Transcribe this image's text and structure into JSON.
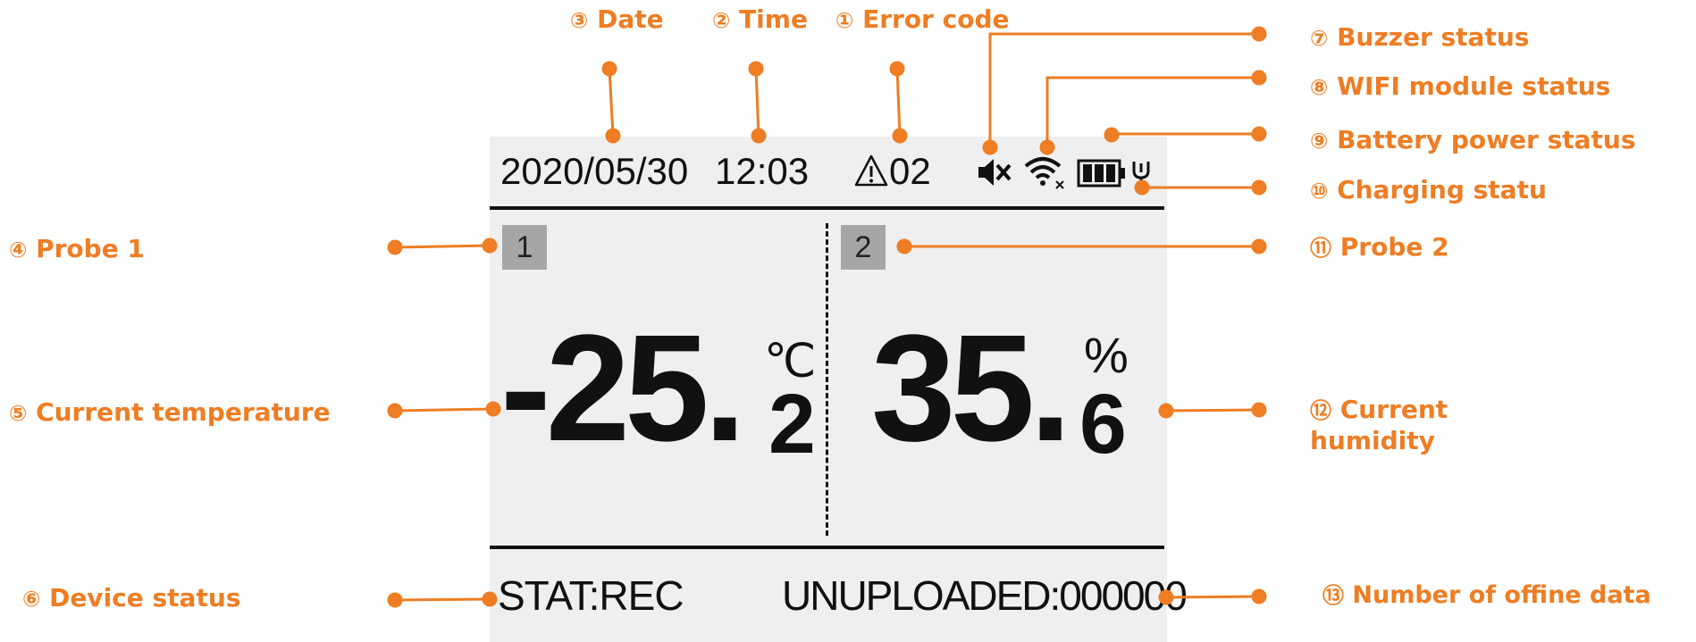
{
  "display": {
    "date": "2020/05/30",
    "time": "12:03",
    "error_code": "02",
    "probe1_badge": "1",
    "probe2_badge": "2",
    "temperature_int": "-25.",
    "temperature_dec": "2",
    "temperature_unit": "℃",
    "humidity_int": "35.",
    "humidity_dec": "6",
    "humidity_unit": "%",
    "status": "STAT:REC",
    "unuploaded": "UNUPLOADED:000000"
  },
  "callouts": {
    "error_code": {
      "num": "①",
      "text": "Error code"
    },
    "time": {
      "num": "②",
      "text": "Time"
    },
    "date": {
      "num": "③",
      "text": "Date"
    },
    "probe1": {
      "num": "④",
      "text": "Probe 1"
    },
    "current_temperature": {
      "num": "⑤",
      "text": "Current temperature"
    },
    "device_status": {
      "num": "⑥",
      "text": "Device status"
    },
    "buzzer_status": {
      "num": "⑦",
      "text": "Buzzer status"
    },
    "wifi_status": {
      "num": "⑧",
      "text": "WIFI module status"
    },
    "battery_status": {
      "num": "⑨",
      "text": "Battery power status"
    },
    "charging_status": {
      "num": "⑩",
      "text": "Charging statu"
    },
    "probe2": {
      "num": "⑪",
      "text": "Probe 2"
    },
    "current_humidity_1": {
      "num": "⑫",
      "text": "Current"
    },
    "current_humidity_2": {
      "text": "humidity"
    },
    "offline_data": {
      "num": "⑬",
      "text": "Number of offine data"
    }
  },
  "colors": {
    "accent": "#ee7d23",
    "screen_bg": "#efefef",
    "badge": "#a6a6a6",
    "text": "#111111"
  },
  "icons": [
    "warning-triangle-icon",
    "speaker-muted-icon",
    "wifi-off-icon",
    "battery-icon",
    "plug-icon"
  ]
}
